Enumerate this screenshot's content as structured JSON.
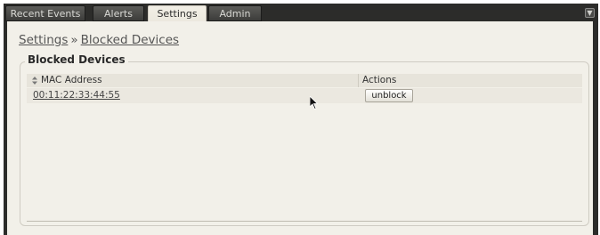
{
  "nav": {
    "tabs": [
      {
        "label": "Recent Events",
        "active": false
      },
      {
        "label": "Alerts",
        "active": false
      },
      {
        "label": "Settings",
        "active": true
      },
      {
        "label": "Admin",
        "active": false
      }
    ],
    "menu_icon": "chevron-down-icon"
  },
  "breadcrumb": {
    "root": "Settings",
    "separator": "»",
    "current": "Blocked Devices"
  },
  "blocked_devices": {
    "legend": "Blocked Devices",
    "columns": [
      "MAC Address",
      "Actions"
    ],
    "sort_icon": "sort-icon",
    "rows": [
      {
        "mac": "00:11:22:33:44:55",
        "action": "unblock"
      }
    ]
  },
  "colors": {
    "frame": "#2c2c2a",
    "content_bg": "#f2f0e9",
    "header_bg": "#e7e4db"
  }
}
